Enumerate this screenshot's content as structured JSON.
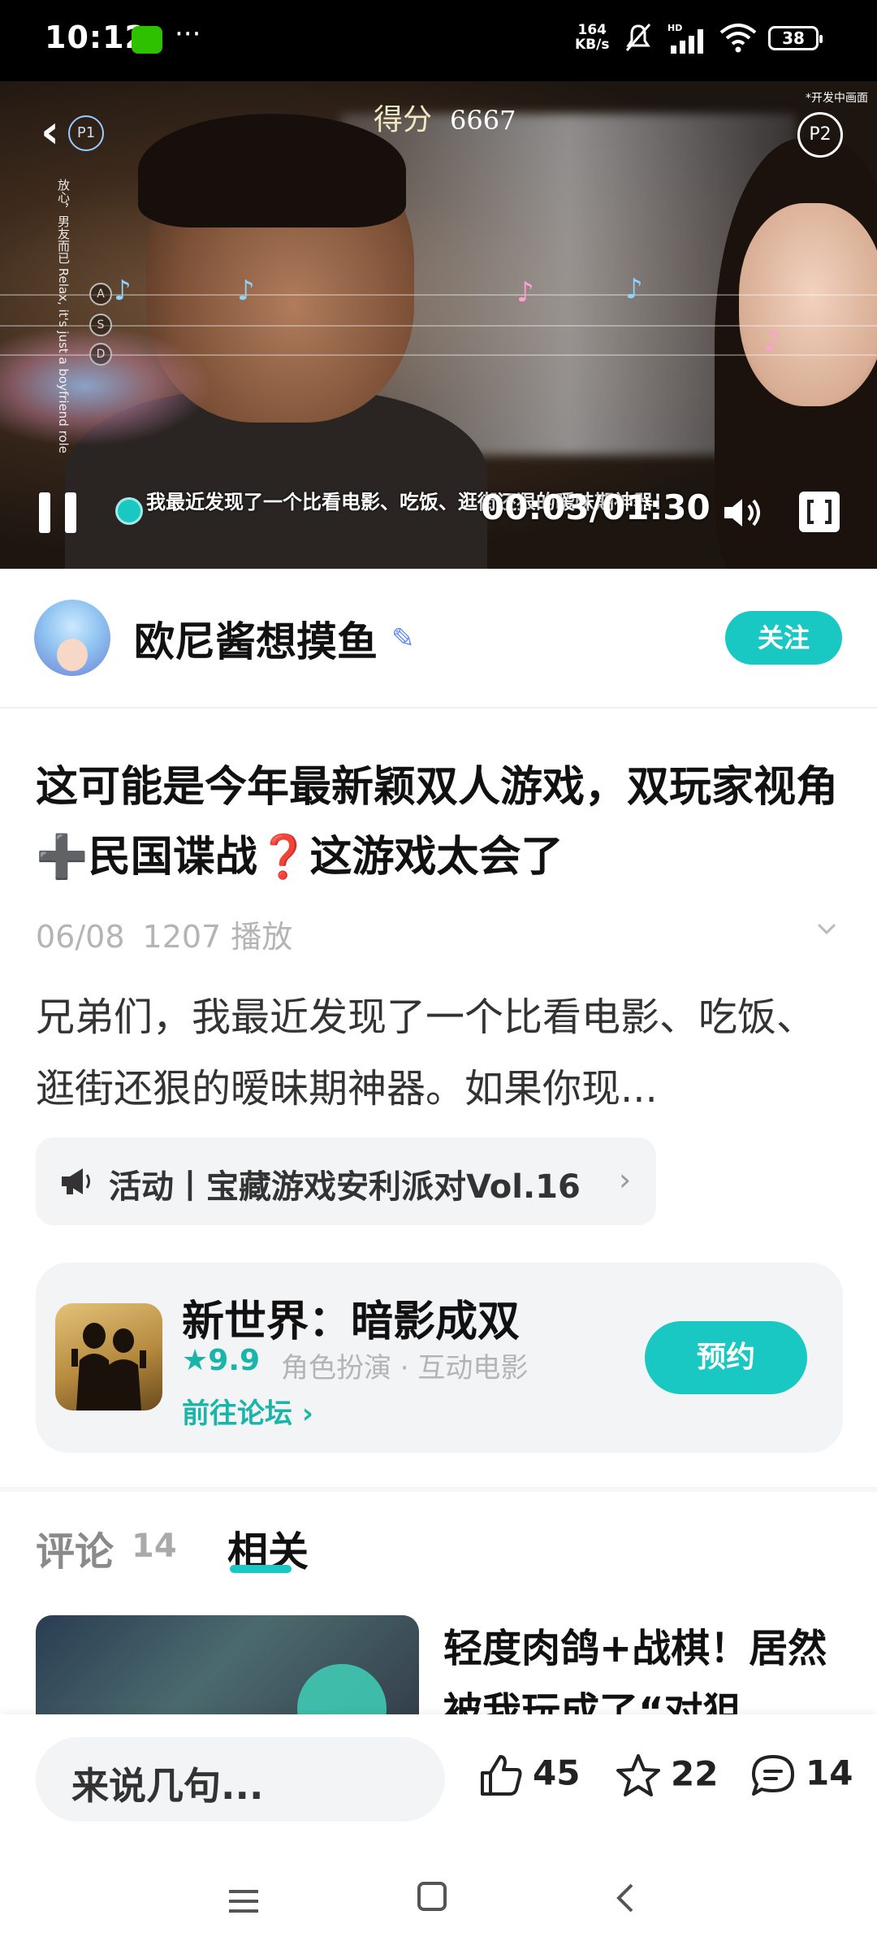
{
  "status_bar": {
    "time": "10:12",
    "more": "···",
    "net_speed_value": "164",
    "net_speed_unit": "KB/s",
    "hd_label": "HD",
    "battery": "38"
  },
  "video": {
    "score_label": "得分",
    "score_value": "6667",
    "side_text": "放心，男友而已 Relax, it's just a boyfriend role",
    "p1_label": "P1",
    "p2_label": "P2",
    "p2_note": "*开发中画面",
    "lane_keys": [
      "A",
      "S",
      "D"
    ],
    "subtitle": "我最近发现了一个比看电影、吃饭、逛街还狠的暧昧期神器！",
    "time": "00:03/01:30",
    "progress": 0.033,
    "accent": "#19c8c2"
  },
  "author": {
    "name": "欧尼酱想摸鱼",
    "follow_label": "关注"
  },
  "post": {
    "title": "这可能是今年最新颖双人游戏，双玩家视角➕民国谍战❓这游戏太会了",
    "date": "06/08",
    "plays": "1207 播放",
    "description": "兄弟们，我最近发现了一个比看电影、吃饭、逛街还狠的暧昧期神器。如果你现...",
    "activity": "活动丨宝藏游戏安利派对Vol.16"
  },
  "game": {
    "name": "新世界：暗影成双",
    "rating": "9.9",
    "tags": "角色扮演 · 互动电影",
    "forum_link": "前往论坛",
    "reserve_label": "预约"
  },
  "tabs": {
    "comments_label": "评论",
    "comments_count": "14",
    "related_label": "相关"
  },
  "related": {
    "title": "轻度肉鸽+战棋！居然被我玩成了“对狙..."
  },
  "bottom_bar": {
    "input_placeholder": "来说几句...",
    "likes": "45",
    "favorites": "22",
    "comments": "14"
  }
}
